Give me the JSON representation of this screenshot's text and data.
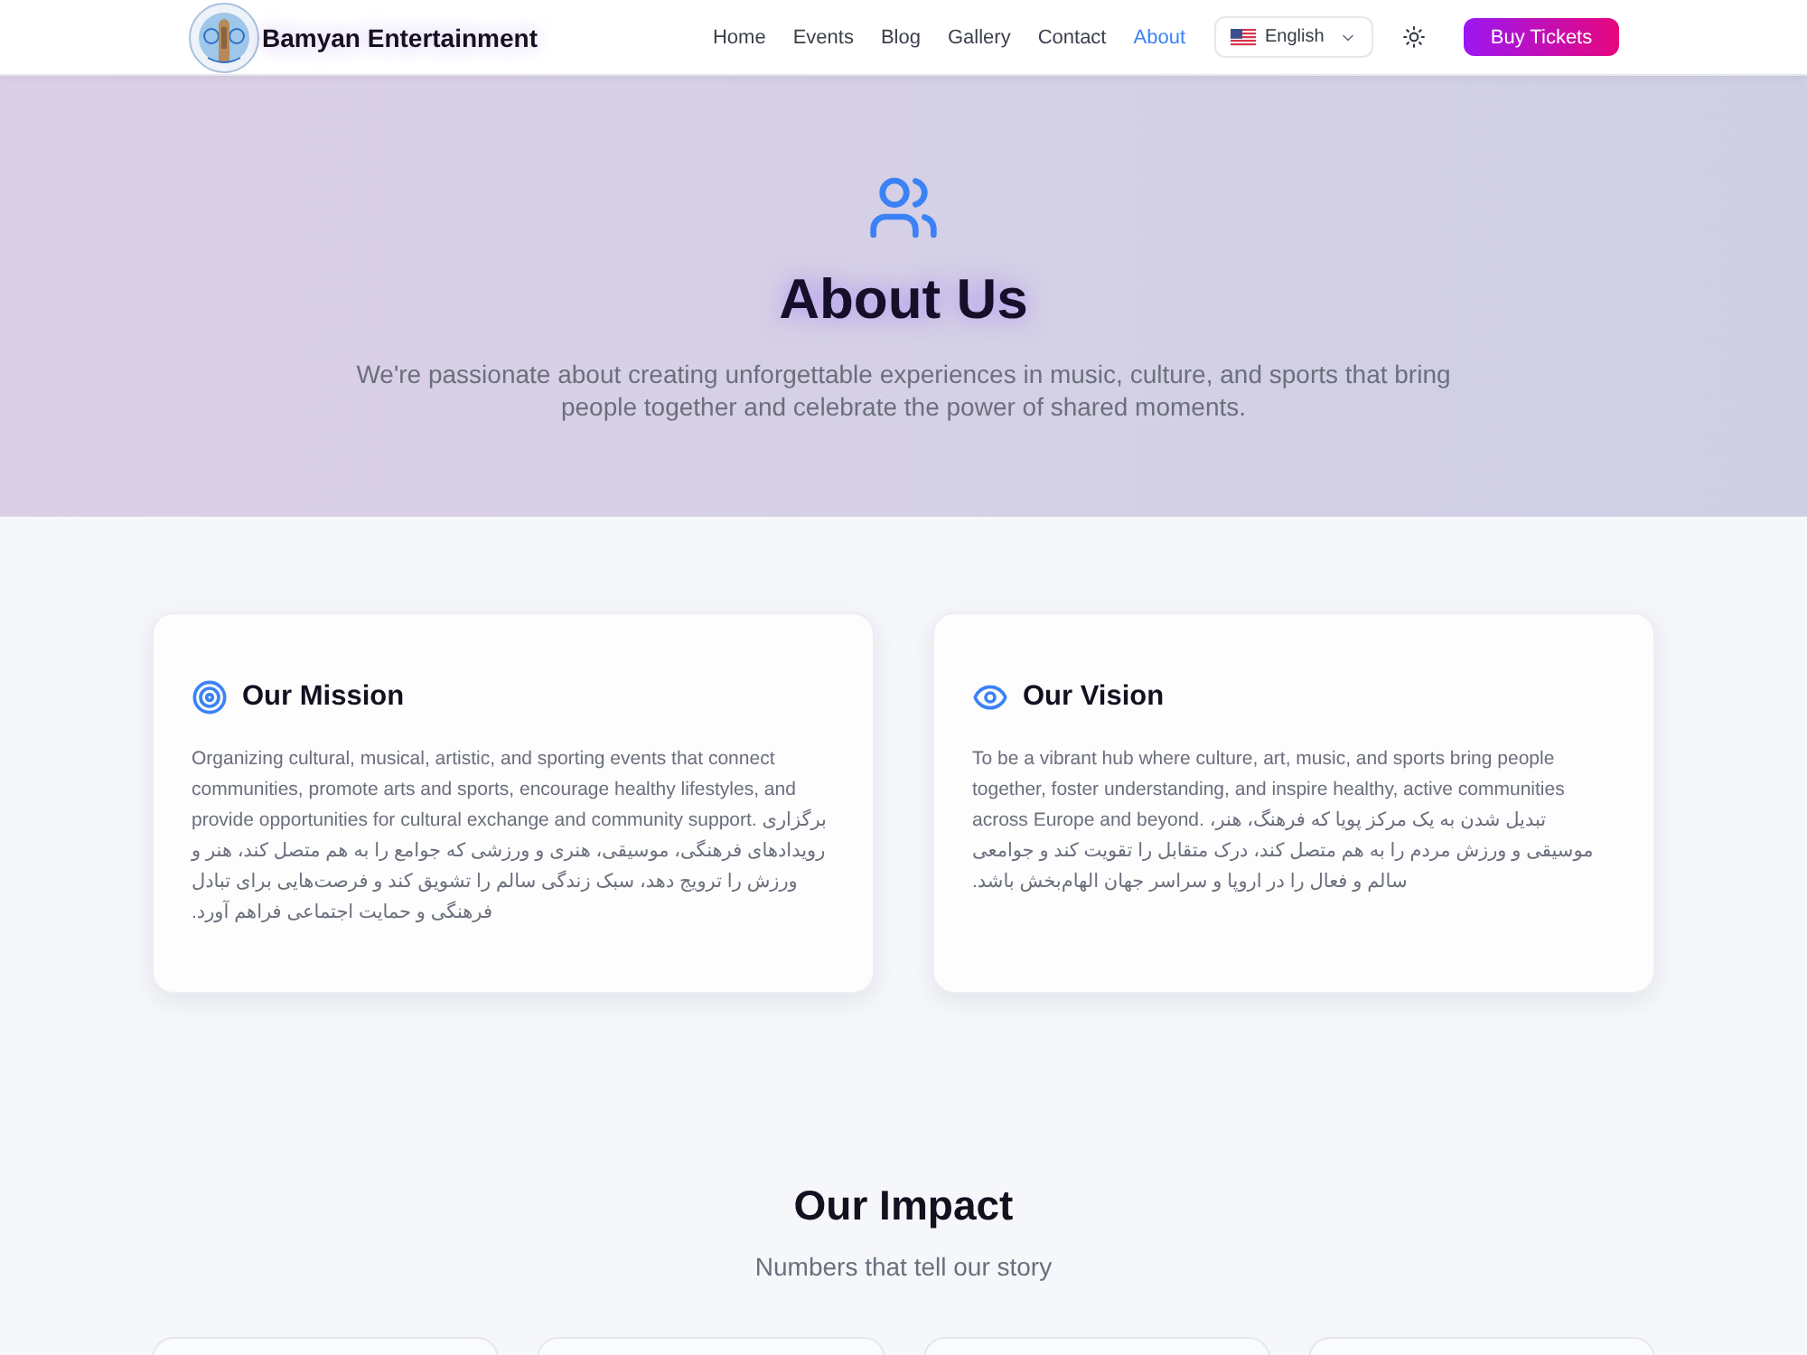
{
  "header": {
    "brand": "Bamyan Entertainment",
    "nav": [
      {
        "label": "Home",
        "selected": false
      },
      {
        "label": "Events",
        "selected": false
      },
      {
        "label": "Blog",
        "selected": false
      },
      {
        "label": "Gallery",
        "selected": false
      },
      {
        "label": "Contact",
        "selected": false
      },
      {
        "label": "About",
        "selected": true
      }
    ],
    "language": {
      "label": "English"
    },
    "cta": "Buy Tickets"
  },
  "hero": {
    "title": "About Us",
    "text": "We're passionate about creating unforgettable experiences in music, culture, and sports that bring people together and celebrate the power of shared moments."
  },
  "mission_card": {
    "title": "Our Mission",
    "text": "Organizing cultural, musical, artistic, and sporting events that connect communities, promote arts and sports, encourage healthy lifestyles, and provide opportunities for cultural exchange and community support.",
    "text_fa": "برگزاری رویدادهای فرهنگی، موسیقی، هنری و ورزشی که جوامع را به هم متصل کند، هنر و ورزش را ترویج دهد، سبک زندگی سالم را تشویق کند و فرصت‌هایی برای تبادل فرهنگی و حمایت اجتماعی فراهم آورد."
  },
  "vision_card": {
    "title": "Our Vision",
    "text": "To be a vibrant hub where culture, art, music, and sports bring people together, foster understanding, and inspire healthy, active communities across Europe and beyond.",
    "text_fa": "تبدیل شدن به یک مرکز پویا که فرهنگ، هنر، موسیقی و ورزش مردم را به هم متصل کند، درک متقابل را تقویت کند و جوامعی سالم و فعال را در اروپا و سراسر جهان الهام‌بخش باشد."
  },
  "impact": {
    "title": "Our Impact",
    "subtitle": "Numbers that tell our story",
    "stat_cards": [
      {
        "kind": "stat"
      },
      {
        "kind": "stat"
      },
      {
        "kind": "stat"
      },
      {
        "kind": "stat"
      }
    ]
  }
}
